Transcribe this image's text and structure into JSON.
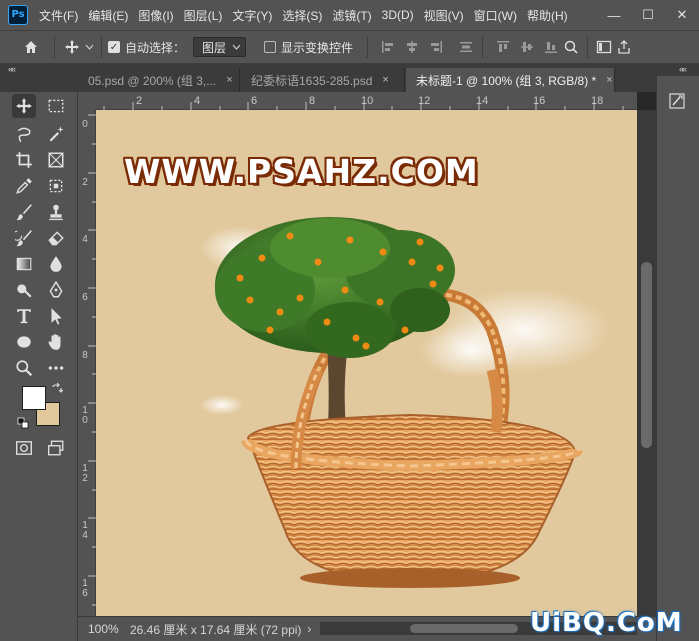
{
  "app": {
    "logo": "Ps"
  },
  "menu": [
    "文件(F)",
    "编辑(E)",
    "图像(I)",
    "图层(L)",
    "文字(Y)",
    "选择(S)",
    "滤镜(T)",
    "3D(D)",
    "视图(V)",
    "窗口(W)",
    "帮助(H)"
  ],
  "window_controls": {
    "minimize": "—",
    "restore": "☐",
    "close": "✕"
  },
  "options": {
    "auto_select_label": "自动选择：",
    "auto_select_checked": true,
    "auto_select_target": "图层",
    "show_transform_label": "显示变换控件",
    "show_transform_checked": false
  },
  "tabs": [
    {
      "label": "05.psd @ 200% (组 3,...",
      "close": "×",
      "active": false
    },
    {
      "label": "纪委标语1635-285.psd",
      "close": "×",
      "active": false
    },
    {
      "label": "未标题-1 @ 100% (组 3, RGB/8) *",
      "close": "×",
      "active": true
    }
  ],
  "ruler_top": [
    "2",
    "4",
    "6",
    "8",
    "10",
    "12",
    "14",
    "16",
    "18"
  ],
  "ruler_left": [
    "0",
    "2",
    "4",
    "6",
    "8",
    "10",
    "12",
    "14",
    "16"
  ],
  "canvas": {
    "watermark_text": "WWW.PSAHZ.COM",
    "background_color": "#e2c99d"
  },
  "colors": {
    "foreground": "#ffffff",
    "background": "#e2c99d",
    "accent": "#31a8ff"
  },
  "status": {
    "zoom": "100%",
    "info": "26.46 厘米 x 17.64 厘米 (72 ppi)",
    "arrow": "›"
  },
  "site_watermark": "UiBQ.CoM",
  "panel_collapse": "««"
}
